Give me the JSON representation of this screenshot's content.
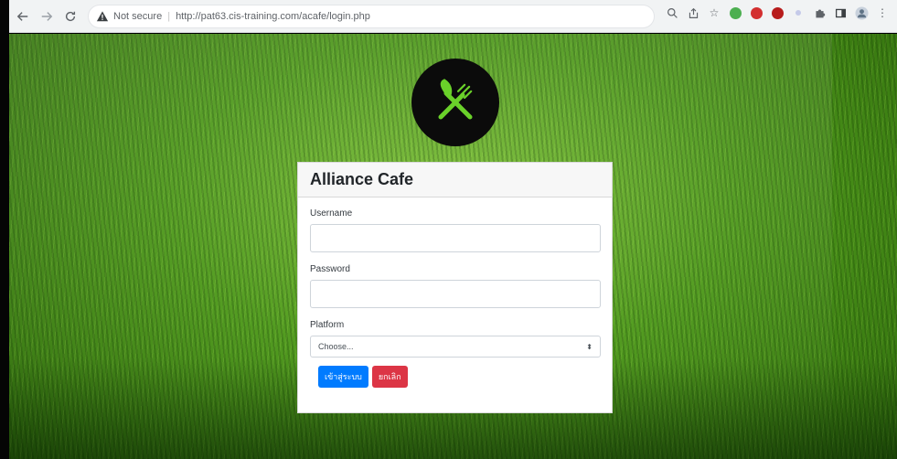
{
  "browser": {
    "security_label": "Not secure",
    "url": "http://pat63.cis-training.com/acafe/login.php"
  },
  "login": {
    "title": "Alliance Cafe",
    "username_label": "Username",
    "username_value": "",
    "password_label": "Password",
    "password_value": "",
    "platform_label": "Platform",
    "platform_selected": "Choose...",
    "submit_label": "เข้าสู่ระบบ",
    "cancel_label": "ยกเลิก"
  },
  "colors": {
    "primary": "#007bff",
    "danger": "#dc3545",
    "logo_bg": "#0b0b0b",
    "logo_icon": "#6ad12a"
  }
}
